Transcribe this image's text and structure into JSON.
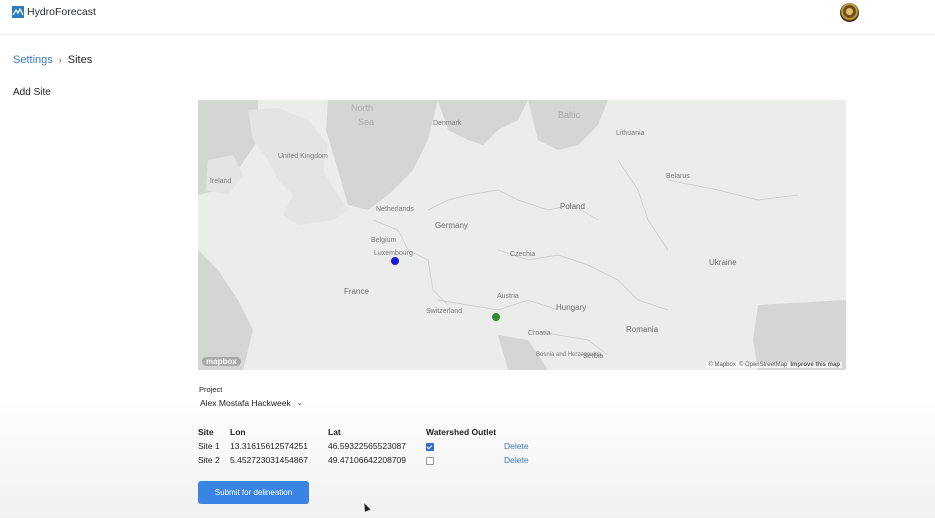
{
  "header": {
    "app_title": "HydroForecast",
    "logo_icon": "hydroforecast-logo-icon",
    "avatar_icon": "user-avatar-icon"
  },
  "breadcrumb": {
    "parent": "Settings",
    "separator": "›",
    "current": "Sites"
  },
  "section_title": "Add Site",
  "map": {
    "sea_labels": [
      "North",
      "Sea",
      "Baltic"
    ],
    "countries": [
      "Ireland",
      "United Kingdom",
      "Denmark",
      "Lithuania",
      "Belarus",
      "Netherlands",
      "Belgium",
      "Germany",
      "Poland",
      "Czechia",
      "Ukraine",
      "France",
      "Austria",
      "Hungary",
      "Switzerland",
      "Croatia",
      "Romania",
      "Bosnia and Herzegovina",
      "Serbia",
      "Luxembourg"
    ],
    "attribution": [
      "© Mapbox",
      "© OpenStreetMap",
      "Improve this map"
    ],
    "logo_text": "mapbox",
    "markers": [
      {
        "site": "Site 1",
        "color": "#2e8b2e"
      },
      {
        "site": "Site 2",
        "color": "#1b1be0"
      }
    ]
  },
  "project": {
    "label": "Project",
    "selected": "Alex Mostafa Hackweek"
  },
  "table": {
    "headers": [
      "Site",
      "Lon",
      "Lat",
      "Watershed Outlet"
    ],
    "rows": [
      {
        "site": "Site 1",
        "lon": "13.31615612574251",
        "lat": "46.59322565523087",
        "watershed_outlet": true,
        "action": "Delete"
      },
      {
        "site": "Site 2",
        "lon": "5.452723031454867",
        "lat": "49.47106642208709",
        "watershed_outlet": false,
        "action": "Delete"
      }
    ]
  },
  "submit_label": "Submit for delineation",
  "colors": {
    "accent": "#3a84e6",
    "link": "#3a78c3",
    "map_land": "#ebedea",
    "map_water": "#d3d6d2"
  }
}
